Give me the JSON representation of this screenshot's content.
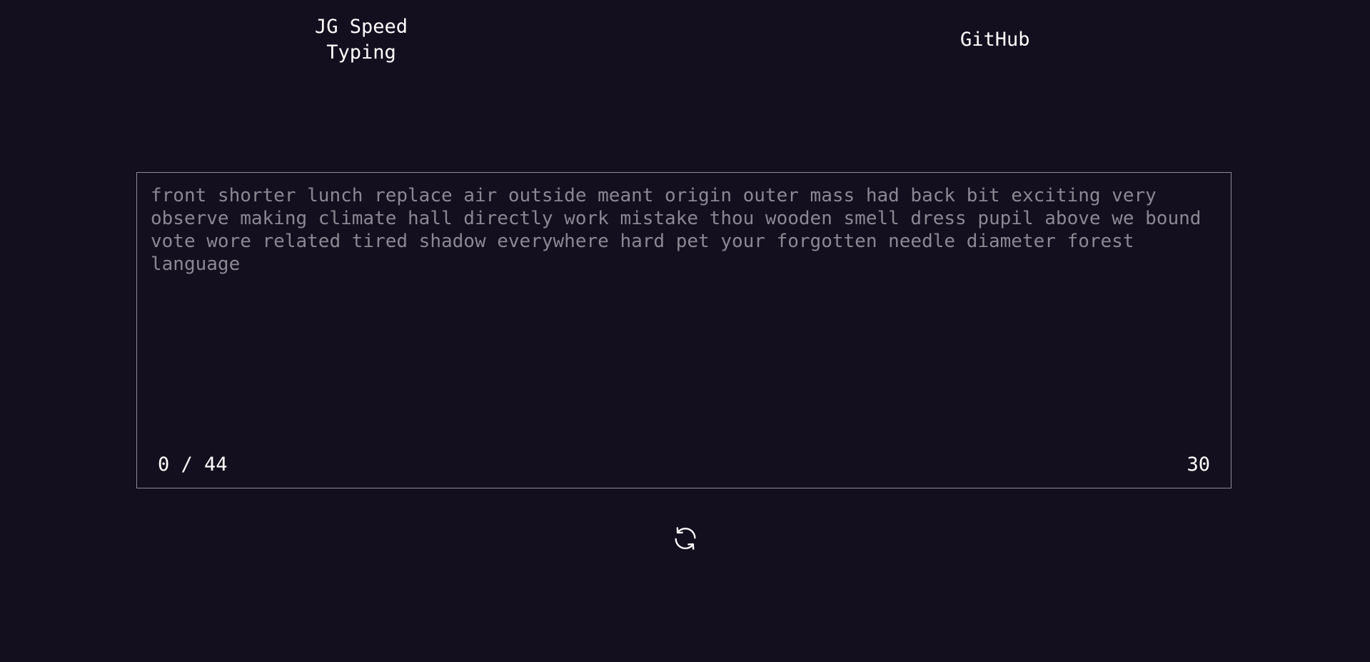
{
  "header": {
    "brand_line1": "JG Speed",
    "brand_line2": "Typing",
    "github_label": "GitHub"
  },
  "test": {
    "words": "front shorter lunch replace air outside meant origin outer mass had back bit exciting very observe making climate hall directly work mistake thou wooden smell dress pupil above we bound vote wore related tired shadow everywhere hard pet your forgotten needle diameter forest language",
    "progress": "0 / 44",
    "timer": "30"
  },
  "controls": {
    "restart_icon": "refresh-icon"
  },
  "colors": {
    "background": "#140f1e",
    "text": "#ffffff",
    "untyped_text": "#8b8793",
    "border": "#8e8a96"
  }
}
